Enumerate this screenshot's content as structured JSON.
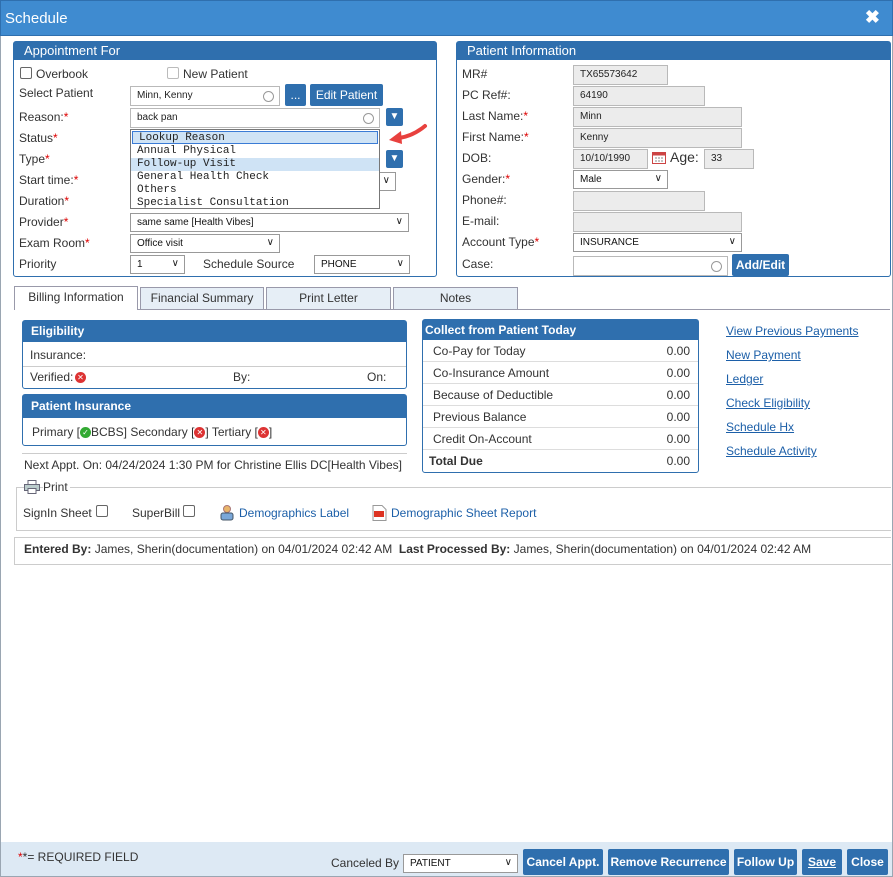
{
  "window": {
    "title": "Schedule"
  },
  "appointment": {
    "header": "Appointment For",
    "overbook_label": "Overbook",
    "new_patient_label": "New Patient",
    "select_patient_label": "Select Patient",
    "select_patient_value": "Minn, Kenny",
    "ellipsis_label": "...",
    "edit_patient_label": "Edit Patient",
    "reason_label": "Reason:",
    "reason_value": "back pan",
    "status_label": "Status",
    "type_label": "Type",
    "start_time_label": "Start time:",
    "duration_label": "Duration",
    "provider_label": "Provider",
    "provider_value": "same same [Health Vibes]",
    "exam_room_label": "Exam Room",
    "exam_room_value": "Office visit",
    "priority_label": "Priority",
    "priority_value": "1",
    "schedule_source_label": "Schedule Source",
    "schedule_source_value": "PHONE",
    "reason_options": [
      "Lookup Reason",
      "Annual Physical",
      "Follow-up Visit",
      "General Health Check",
      "Others",
      "Specialist Consultation"
    ]
  },
  "patient": {
    "header": "Patient Information",
    "mr_label": "MR#",
    "mr_value": "TX65573642",
    "pcref_label": "PC Ref#:",
    "pcref_value": "64190",
    "last_name_label": "Last Name:",
    "last_name_value": "Minn",
    "first_name_label": "First Name:",
    "first_name_value": "Kenny",
    "dob_label": "DOB:",
    "dob_value": "10/10/1990",
    "age_label": "Age:",
    "age_value": "33",
    "gender_label": "Gender:",
    "gender_value": "Male",
    "phone_label": "Phone#:",
    "phone_value": "",
    "email_label": "E-mail:",
    "email_value": "",
    "account_type_label": "Account Type",
    "account_type_value": "INSURANCE",
    "case_label": "Case:",
    "case_value": "",
    "add_edit_label": "Add/Edit"
  },
  "tabs": [
    "Billing Information",
    "Financial Summary",
    "Print Letter",
    "Notes"
  ],
  "eligibility": {
    "header": "Eligibility",
    "insurance_label": "Insurance:",
    "verified_label": "Verified:",
    "by_label": "By:",
    "on_label": "On:"
  },
  "patient_insurance": {
    "header": "Patient Insurance",
    "primary_label": "Primary [",
    "primary_value": "BCBS]",
    "secondary_label": "Secondary [",
    "tertiary_label": "Tertiary [",
    "close_bracket": "]"
  },
  "next_appt": "Next Appt. On: 04/24/2024 1:30 PM for Christine Ellis DC[Health Vibes]",
  "collect": {
    "header": "Collect from Patient Today",
    "rows": [
      {
        "label": "Co-Pay for Today",
        "value": "0.00"
      },
      {
        "label": "Co-Insurance Amount",
        "value": "0.00"
      },
      {
        "label": "Because of Deductible",
        "value": "0.00"
      },
      {
        "label": "Previous Balance",
        "value": "0.00"
      },
      {
        "label": "Credit On-Account",
        "value": "0.00"
      }
    ],
    "total_label": "Total Due",
    "total_value": "0.00"
  },
  "links": [
    "View Previous Payments",
    "New Payment",
    "Ledger",
    "Check Eligibility",
    "Schedule Hx",
    "Schedule Activity"
  ],
  "print": {
    "legend": "Print",
    "signin_label": "SignIn Sheet",
    "superbill_label": "SuperBill",
    "demographics_label": "Demographics Label",
    "demographic_sheet_label": "Demographic Sheet Report"
  },
  "audit": {
    "entered_by_label": "Entered By:",
    "entered_by_value": "James, Sherin(documentation) on 04/01/2024 02:42 AM",
    "last_processed_label": "Last Processed By:",
    "last_processed_value": "James, Sherin(documentation) on 04/01/2024 02:42 AM"
  },
  "footer": {
    "required_note": "*= REQUIRED FIELD",
    "canceled_by_label": "Canceled By",
    "canceled_by_value": "PATIENT",
    "cancel_appt": "Cancel Appt.",
    "remove_recurrence": "Remove Recurrence",
    "follow_up": "Follow Up",
    "save": "Save",
    "close": "Close"
  },
  "colors": {
    "primary": "#2f6fae",
    "title_bar": "#3f8bd0",
    "required": "#dd0000",
    "link": "#1c5fa8"
  }
}
